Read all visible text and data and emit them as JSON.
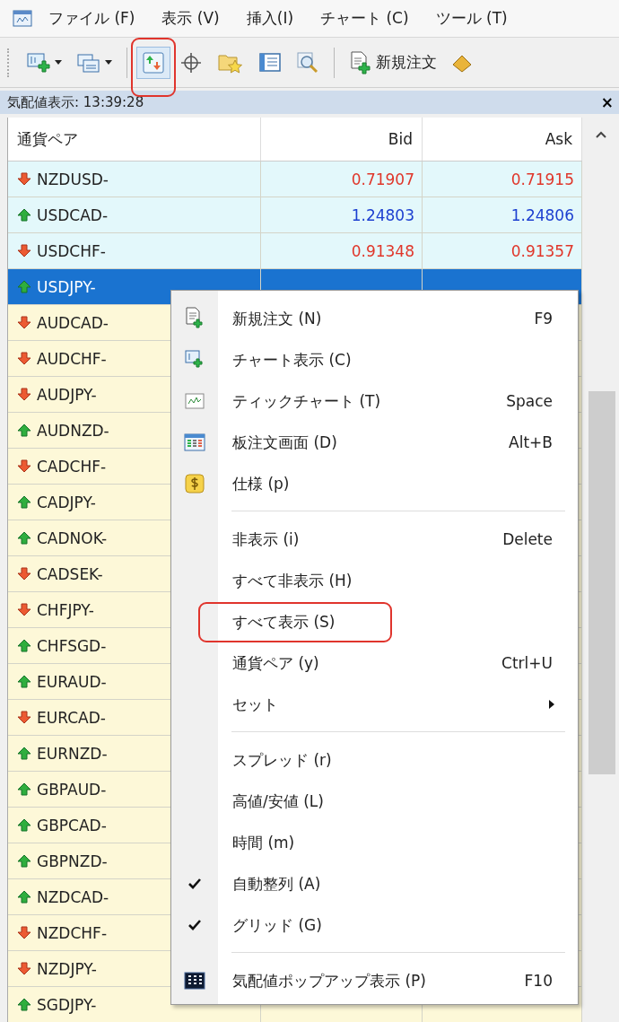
{
  "menubar": {
    "items": [
      "ファイル (F)",
      "表示 (V)",
      "挿入(I)",
      "チャート (C)",
      "ツール (T)"
    ]
  },
  "toolbar": {
    "buttons": [
      {
        "kind": "icon",
        "dropdown": true,
        "pressed": false,
        "highlighted": false
      },
      {
        "kind": "icon",
        "dropdown": true,
        "pressed": false,
        "highlighted": false
      },
      {
        "kind": "separator"
      },
      {
        "kind": "icon",
        "dropdown": false,
        "pressed": true,
        "highlighted": true
      },
      {
        "kind": "icon",
        "dropdown": false,
        "pressed": false,
        "highlighted": false
      },
      {
        "kind": "icon",
        "dropdown": false,
        "pressed": false,
        "highlighted": false
      },
      {
        "kind": "icon",
        "dropdown": false,
        "pressed": false,
        "highlighted": false
      },
      {
        "kind": "icon",
        "dropdown": false,
        "pressed": false,
        "highlighted": false
      },
      {
        "kind": "separator"
      },
      {
        "kind": "labeled",
        "label": "新規注文",
        "dropdown": false,
        "pressed": false,
        "highlighted": false
      },
      {
        "kind": "icon",
        "dropdown": false,
        "pressed": false,
        "highlighted": false
      }
    ]
  },
  "panel": {
    "title": "気配値表示: 13:39:28",
    "close": "×"
  },
  "table": {
    "columns": [
      "通貨ペア",
      "Bid",
      "Ask"
    ],
    "rows": [
      {
        "symbol": "NZDUSD-",
        "kind": "down",
        "bid": "0.71907",
        "ask": "0.71915",
        "color": "#e3f8fb",
        "selected": false
      },
      {
        "symbol": "USDCAD-",
        "kind": "up",
        "bid": "1.24803",
        "ask": "1.24806",
        "color": "#e3f8fb",
        "selected": false
      },
      {
        "symbol": "USDCHF-",
        "kind": "down",
        "bid": "0.91348",
        "ask": "0.91357",
        "color": "#e3f8fb",
        "selected": false
      },
      {
        "symbol": "USDJPY-",
        "kind": "up",
        "selected": true
      },
      {
        "symbol": "AUDCAD-",
        "kind": "down",
        "color": "#fdf8d8",
        "selected": false
      },
      {
        "symbol": "AUDCHF-",
        "kind": "down",
        "color": "#fdf8d8",
        "selected": false
      },
      {
        "symbol": "AUDJPY-",
        "kind": "down",
        "color": "#fdf8d8",
        "selected": false
      },
      {
        "symbol": "AUDNZD-",
        "kind": "up",
        "color": "#fdf8d8",
        "selected": false
      },
      {
        "symbol": "CADCHF-",
        "kind": "down",
        "color": "#fdf8d8",
        "selected": false
      },
      {
        "symbol": "CADJPY-",
        "kind": "up",
        "color": "#fdf8d8",
        "selected": false
      },
      {
        "symbol": "CADNOK-",
        "kind": "up",
        "color": "#fdf8d8",
        "selected": false
      },
      {
        "symbol": "CADSEK-",
        "kind": "down",
        "color": "#fdf8d8",
        "selected": false
      },
      {
        "symbol": "CHFJPY-",
        "kind": "down",
        "color": "#fdf8d8",
        "selected": false
      },
      {
        "symbol": "CHFSGD-",
        "kind": "up",
        "color": "#fdf8d8",
        "selected": false
      },
      {
        "symbol": "EURAUD-",
        "kind": "up",
        "color": "#fdf8d8",
        "selected": false
      },
      {
        "symbol": "EURCAD-",
        "kind": "down",
        "color": "#fdf8d8",
        "selected": false
      },
      {
        "symbol": "EURNZD-",
        "kind": "up",
        "color": "#fdf8d8",
        "selected": false
      },
      {
        "symbol": "GBPAUD-",
        "kind": "up",
        "color": "#fdf8d8",
        "selected": false
      },
      {
        "symbol": "GBPCAD-",
        "kind": "up",
        "color": "#fdf8d8",
        "selected": false
      },
      {
        "symbol": "GBPNZD-",
        "kind": "up",
        "color": "#fdf8d8",
        "selected": false
      },
      {
        "symbol": "NZDCAD-",
        "kind": "up",
        "color": "#fdf8d8",
        "selected": false
      },
      {
        "symbol": "NZDCHF-",
        "kind": "down",
        "color": "#fdf8d8",
        "selected": false
      },
      {
        "symbol": "NZDJPY-",
        "kind": "down",
        "color": "#fdf8d8",
        "selected": false
      },
      {
        "symbol": "SGDJPY-",
        "kind": "up",
        "color": "#fdf8d8",
        "selected": false
      }
    ]
  },
  "context_menu": {
    "items": [
      {
        "kind": "item",
        "label": "新規注文 (N)",
        "shortcut": "F9",
        "checked": false,
        "submenu": false,
        "highlighted": false
      },
      {
        "kind": "item",
        "label": "チャート表示 (C)",
        "checked": false,
        "submenu": false,
        "highlighted": false
      },
      {
        "kind": "item",
        "label": "ティックチャート (T)",
        "shortcut": "Space",
        "checked": false,
        "submenu": false,
        "highlighted": false
      },
      {
        "kind": "item",
        "label": "板注文画面 (D)",
        "shortcut": "Alt+B",
        "checked": false,
        "submenu": false,
        "highlighted": false
      },
      {
        "kind": "item",
        "label": "仕様 (p)",
        "checked": false,
        "submenu": false,
        "highlighted": false
      },
      {
        "kind": "separator"
      },
      {
        "kind": "item",
        "label": "非表示 (i)",
        "shortcut": "Delete",
        "checked": false,
        "submenu": false,
        "highlighted": false
      },
      {
        "kind": "item",
        "label": "すべて非表示 (H)",
        "checked": false,
        "submenu": false,
        "highlighted": false
      },
      {
        "kind": "item",
        "label": "すべて表示 (S)",
        "checked": false,
        "submenu": false,
        "highlighted": true
      },
      {
        "kind": "item",
        "label": "通貨ペア (y)",
        "shortcut": "Ctrl+U",
        "checked": false,
        "submenu": false,
        "highlighted": false
      },
      {
        "kind": "item",
        "label": "セット",
        "checked": false,
        "submenu": true,
        "highlighted": false
      },
      {
        "kind": "separator"
      },
      {
        "kind": "item",
        "label": "スプレッド (r)",
        "checked": false,
        "submenu": false,
        "highlighted": false
      },
      {
        "kind": "item",
        "label": "高値/安値 (L)",
        "checked": false,
        "submenu": false,
        "highlighted": false
      },
      {
        "kind": "item",
        "label": "時間 (m)",
        "checked": false,
        "submenu": false,
        "highlighted": false
      },
      {
        "kind": "item",
        "label": "自動整列 (A)",
        "checked": true,
        "submenu": false,
        "highlighted": false
      },
      {
        "kind": "item",
        "label": "グリッド (G)",
        "checked": true,
        "submenu": false,
        "highlighted": false
      },
      {
        "kind": "separator"
      },
      {
        "kind": "item",
        "label": "気配値ポップアップ表示 (P)",
        "shortcut": "F10",
        "checked": false,
        "submenu": false,
        "highlighted": false
      }
    ]
  }
}
